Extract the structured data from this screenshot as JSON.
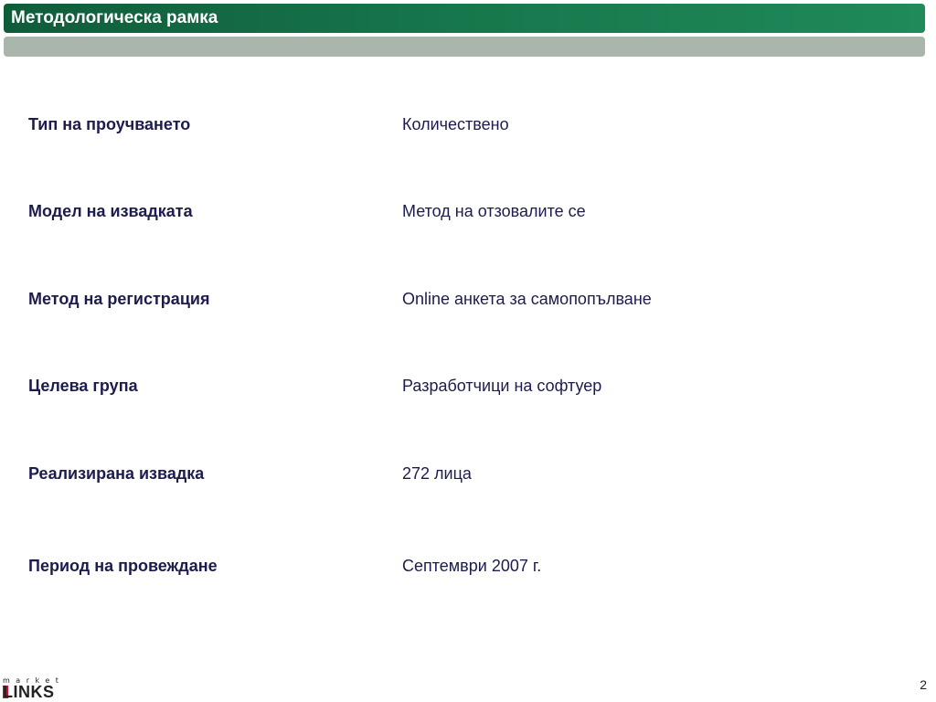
{
  "header": {
    "title": "Методологическа рамка"
  },
  "rows": [
    {
      "label": "Тип на проучването",
      "value": "Количествено"
    },
    {
      "label": "Модел на извадката",
      "value": "Метод на отзовалите се"
    },
    {
      "label": "Метод на регистрация",
      "value": "Online анкета за самопопълване"
    },
    {
      "label": "Целева група",
      "value": "Разработчици на софтуер"
    },
    {
      "label": "Реализирана извадка",
      "value": "272 лица"
    },
    {
      "label": "Период на провеждане",
      "value": "Септември 2007 г."
    }
  ],
  "footer": {
    "logo_top": "market",
    "logo_bottom": "LINKS",
    "page_number": "2"
  },
  "colors": {
    "title_bar": "#17774c",
    "sub_bar": "#aab5ab",
    "text": "#1c1c4e",
    "logo_accent": "#c8102e"
  }
}
